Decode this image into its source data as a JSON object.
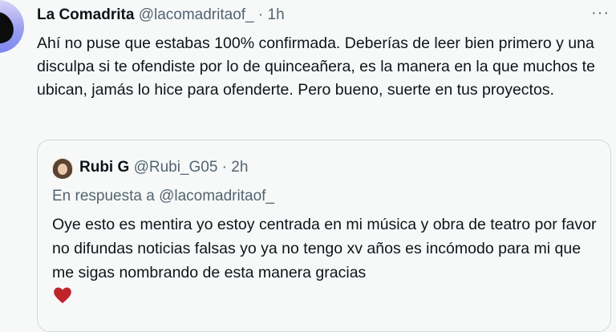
{
  "tweet": {
    "author_name": "La Comadrita",
    "handle": "@lacomadritaof_",
    "time": " · 1h",
    "more_icon": "···",
    "text": "Ahí no puse que estabas 100% confirmada. Deberías de leer bien primero y una disculpa si te ofendiste por lo de quinceañera, es la manera en la que muchos te ubican, jamás lo hice para ofenderte. Pero bueno, suerte en tus proyectos."
  },
  "quoted": {
    "author_name": "Rubi G",
    "handle": "@Rubi_G05",
    "time": " · 2h",
    "reply_to": "En respuesta a @lacomadritaof_",
    "text": "Oye esto es mentira yo estoy centrada en mi música y obra de teatro por favor no difundas noticias falsas yo ya no tengo xv años es incómodo para mi que me sigas nombrando de esta manera gracias",
    "emoji": "heart-icon"
  },
  "colors": {
    "background": "#f7f9f9",
    "text": "#0f1419",
    "secondary": "#536471",
    "border": "#cfd9de",
    "heart": "#c0242b"
  }
}
